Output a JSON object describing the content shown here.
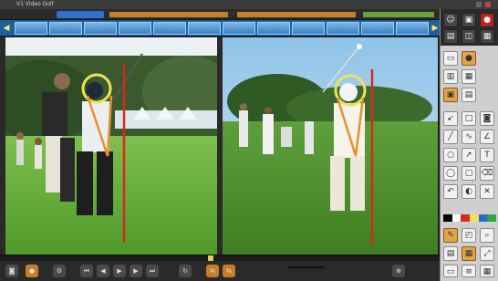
{
  "window": {
    "title": "V1 Video Golf"
  },
  "playback": {
    "progress": 0.48
  },
  "colors": {
    "accent_orange": "#e8902a",
    "swing_line_red": "#d42a1f",
    "head_circle_yellow": "#f1e15a",
    "thumbnail_blue": "#1f5f9e"
  },
  "icons": {
    "transport": [
      "camera-icon",
      "record-icon",
      "settings-icon",
      "skip-back-icon",
      "step-back-icon",
      "play-icon",
      "step-forward-icon",
      "skip-forward-icon",
      "loop-icon"
    ],
    "drawing_tools": [
      "line-icon",
      "square-icon",
      "circle-icon",
      "angle-icon",
      "arrow-icon",
      "text-icon",
      "freehand-icon",
      "eraser-icon"
    ]
  },
  "palette": [
    "#000000",
    "#ffffff",
    "#d42a1f",
    "#f1e15a",
    "#2b6bd0",
    "#2fa34a"
  ]
}
